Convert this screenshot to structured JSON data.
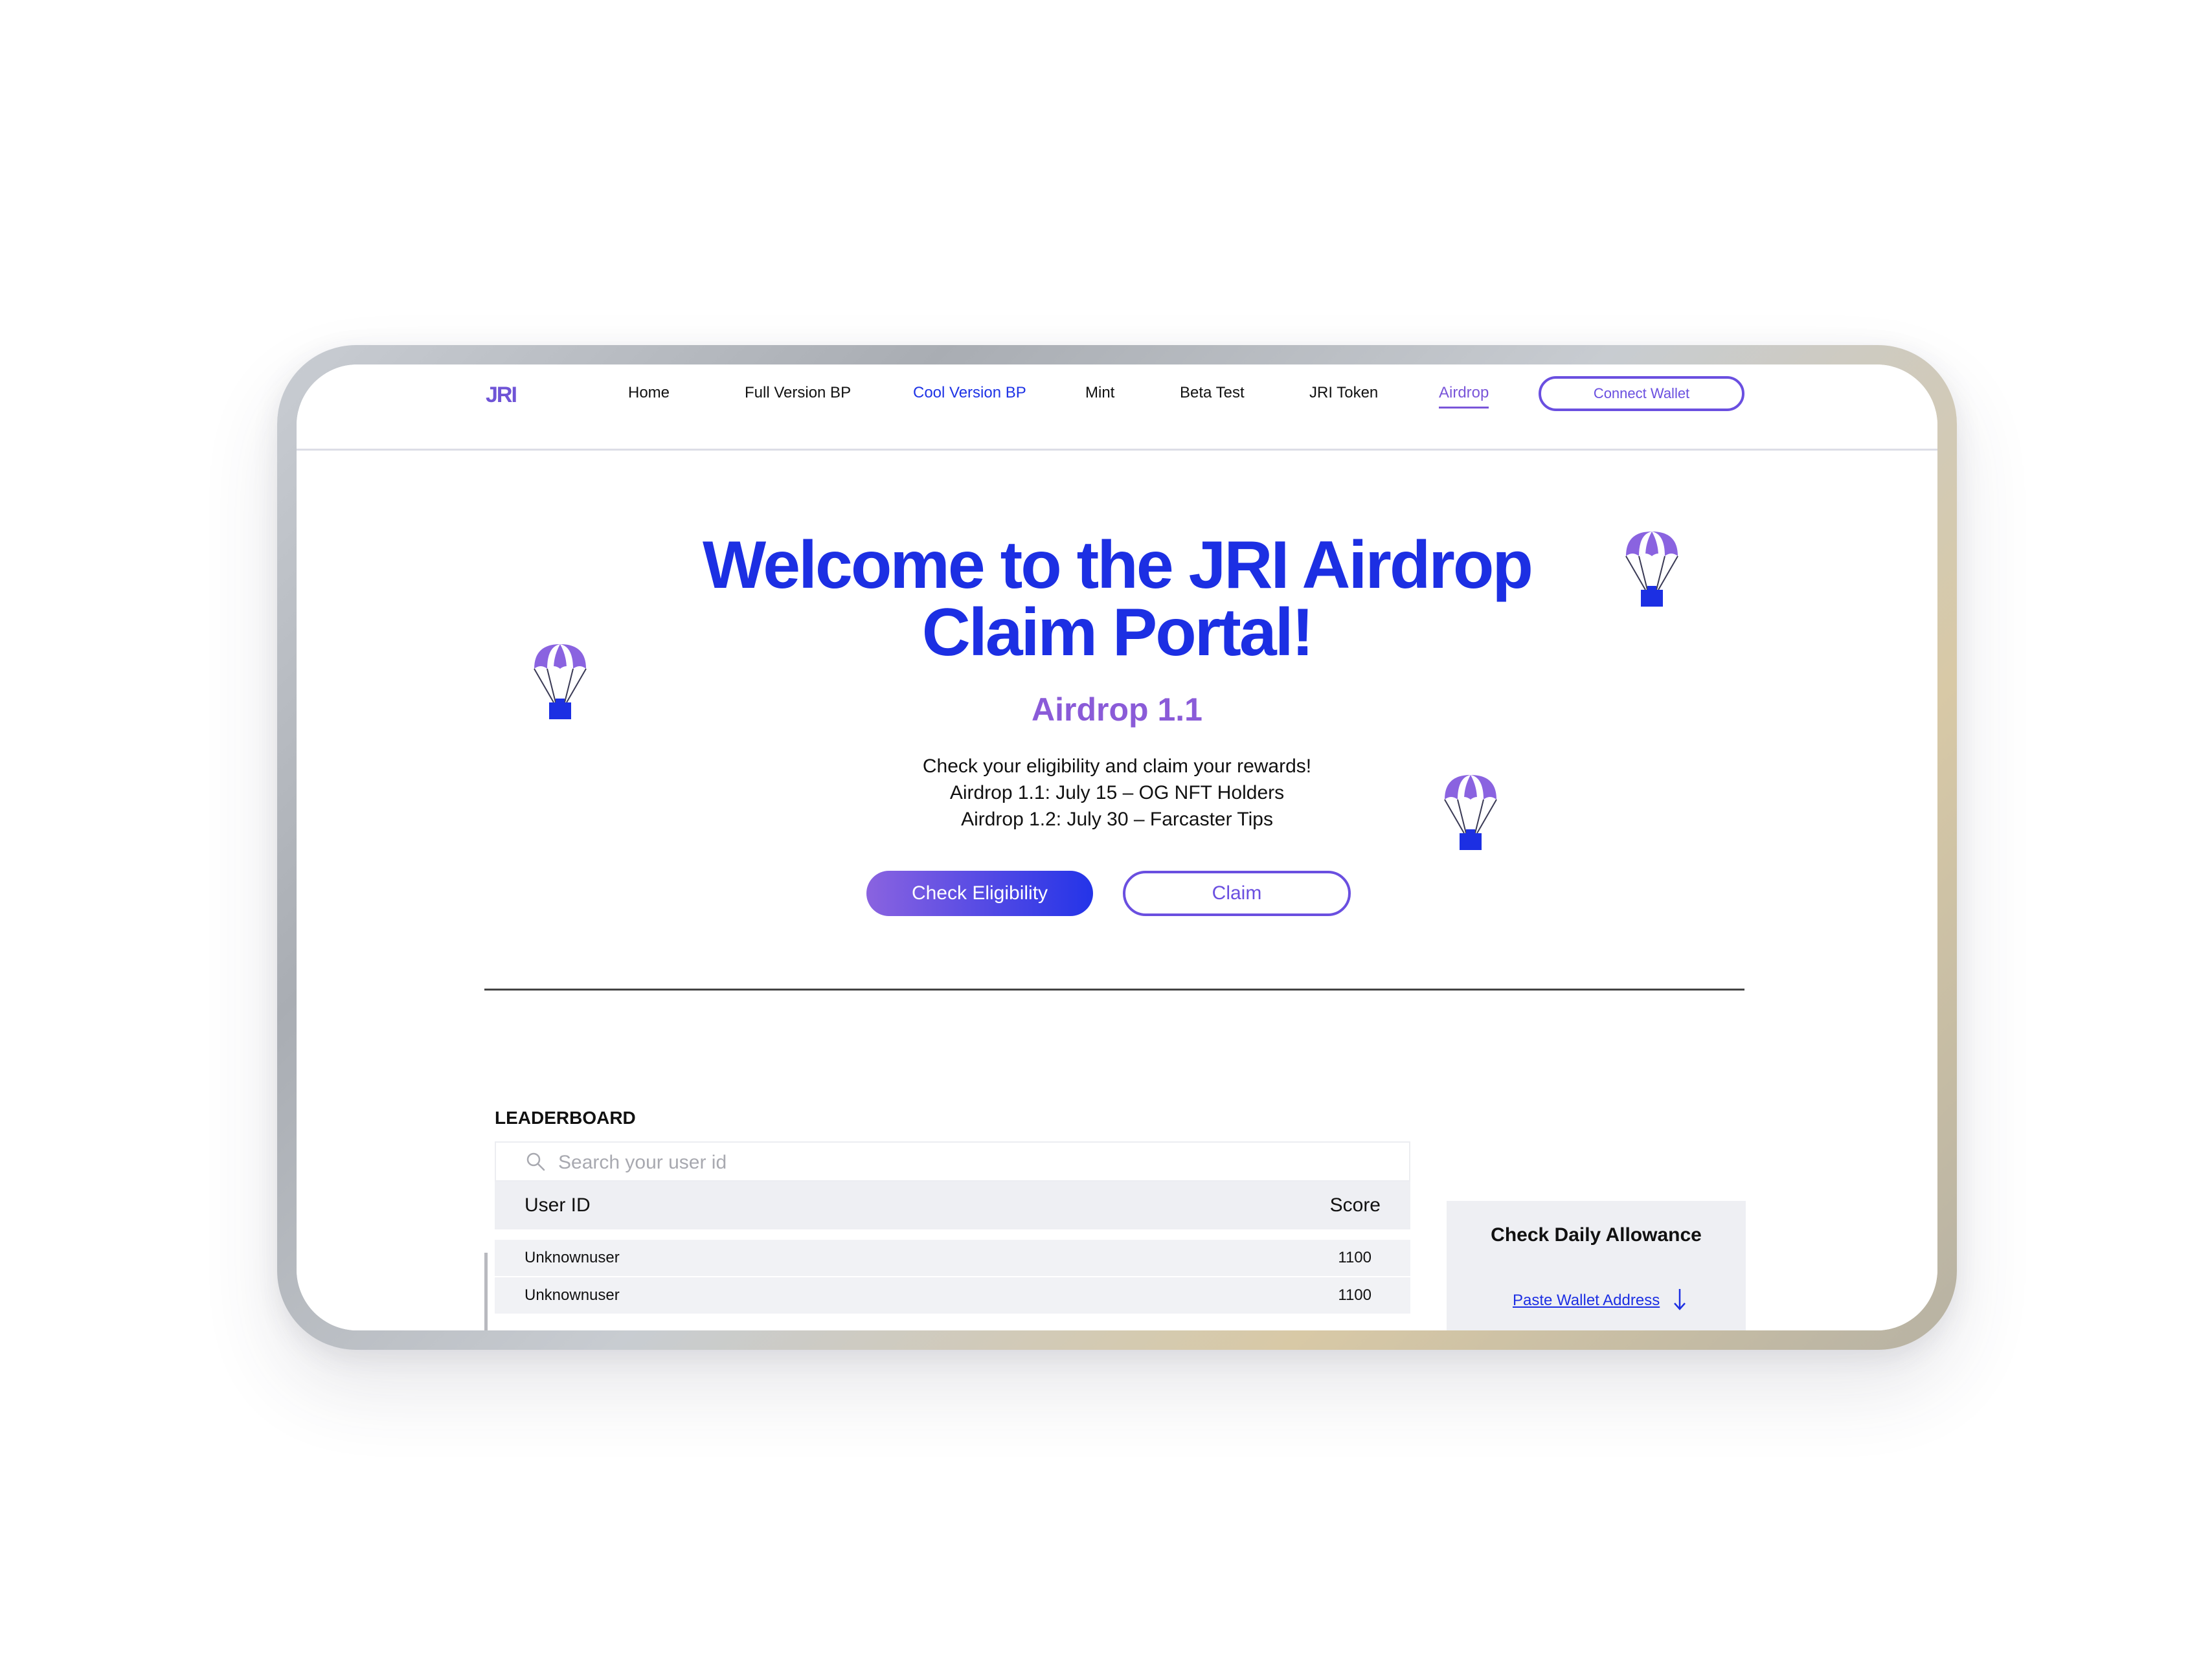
{
  "nav": {
    "logo": "JRI",
    "items": [
      {
        "label": "Home"
      },
      {
        "label": "Full Version BP"
      },
      {
        "label": "Cool Version BP"
      },
      {
        "label": "Mint"
      },
      {
        "label": "Beta Test"
      },
      {
        "label": "JRI Token"
      },
      {
        "label": "Airdrop"
      }
    ],
    "connect_label": "Connect Wallet"
  },
  "hero": {
    "title_line1": "Welcome to the JRI Airdrop",
    "title_line2": "Claim Portal!",
    "subtitle": "Airdrop 1.1",
    "desc_line1": "Check your eligibility and claim your rewards!",
    "desc_line2": "Airdrop 1.1: July 15 –  OG NFT Holders",
    "desc_line3": "Airdrop 1.2: July 30 – Farcaster Tips",
    "check_label": "Check Eligibility",
    "claim_label": "Claim"
  },
  "leaderboard": {
    "title": "LEADERBOARD",
    "search_placeholder": "Search your user id",
    "columns": [
      "User ID",
      "Score"
    ],
    "rows": [
      {
        "user": "Unknownuser",
        "score": "1100"
      },
      {
        "user": "Unknownuser",
        "score": "1100"
      }
    ]
  },
  "allowance": {
    "title": "Check Daily Allowance",
    "link_label": "Paste Wallet Address"
  },
  "colors": {
    "brand_blue": "#1c2fe3",
    "brand_purple": "#7a56d9",
    "accent": "#6a4fe0"
  }
}
